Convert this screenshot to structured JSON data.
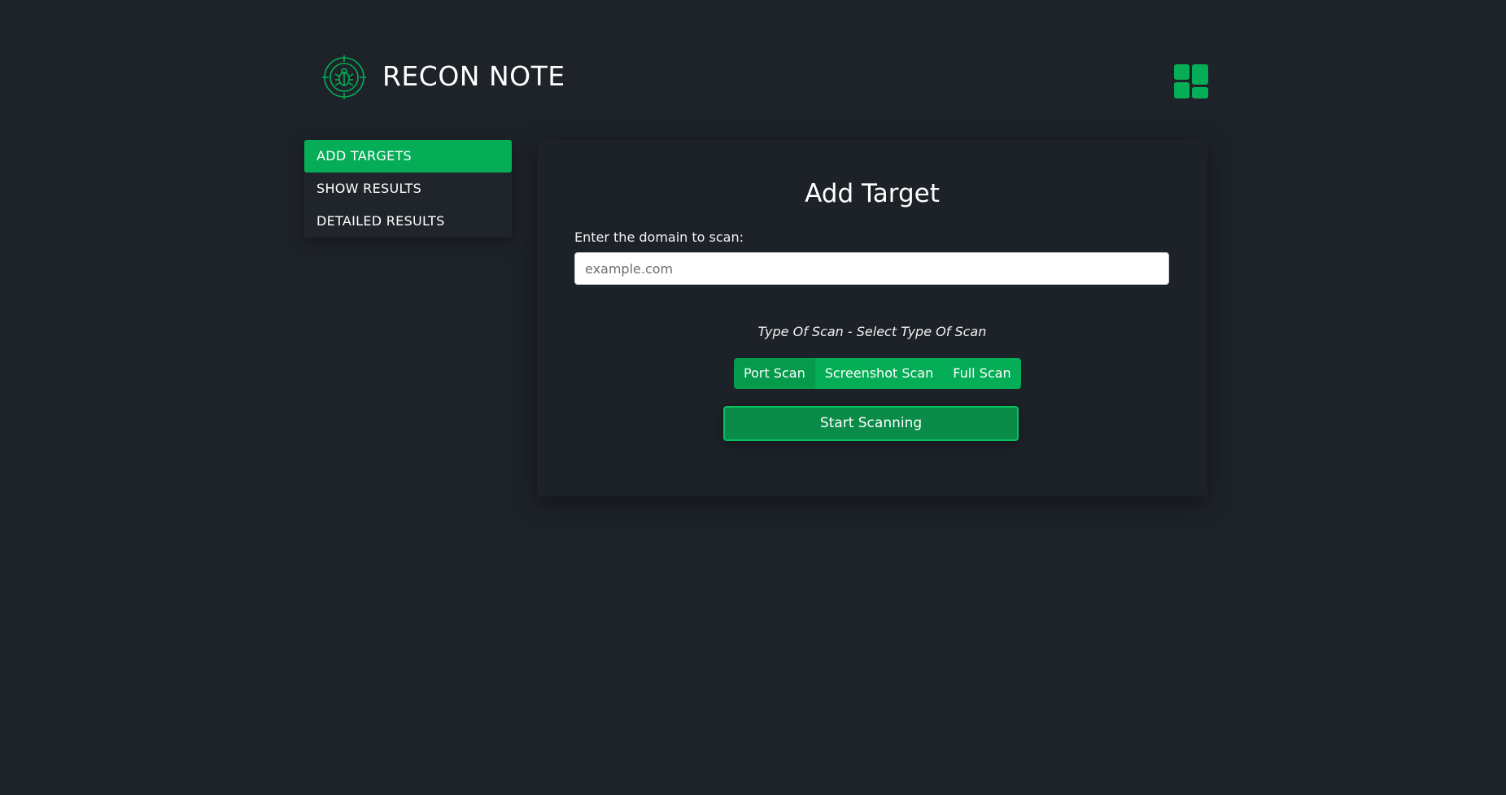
{
  "header": {
    "logo_icon": "bug-crosshair-icon",
    "title": "RECON NOTE",
    "dashboard_icon": "dashboard-grid-icon"
  },
  "sidebar": {
    "items": [
      {
        "label": "ADD TARGETS",
        "active": true
      },
      {
        "label": "SHOW RESULTS",
        "active": false
      },
      {
        "label": "DETAILED RESULTS",
        "active": false
      }
    ]
  },
  "main": {
    "title": "Add Target",
    "domain_label": "Enter the domain to scan:",
    "domain_value": "",
    "domain_placeholder": "example.com",
    "scan_type_label": "Type Of Scan - Select Type Of Scan",
    "scan_types": [
      {
        "label": "Port Scan",
        "active": true
      },
      {
        "label": "Screenshot Scan",
        "active": false
      },
      {
        "label": "Full Scan",
        "active": false
      }
    ],
    "start_button": "Start Scanning"
  },
  "colors": {
    "accent": "#05ad56",
    "accent_dark": "#0a8c48",
    "background": "#1e232a"
  }
}
